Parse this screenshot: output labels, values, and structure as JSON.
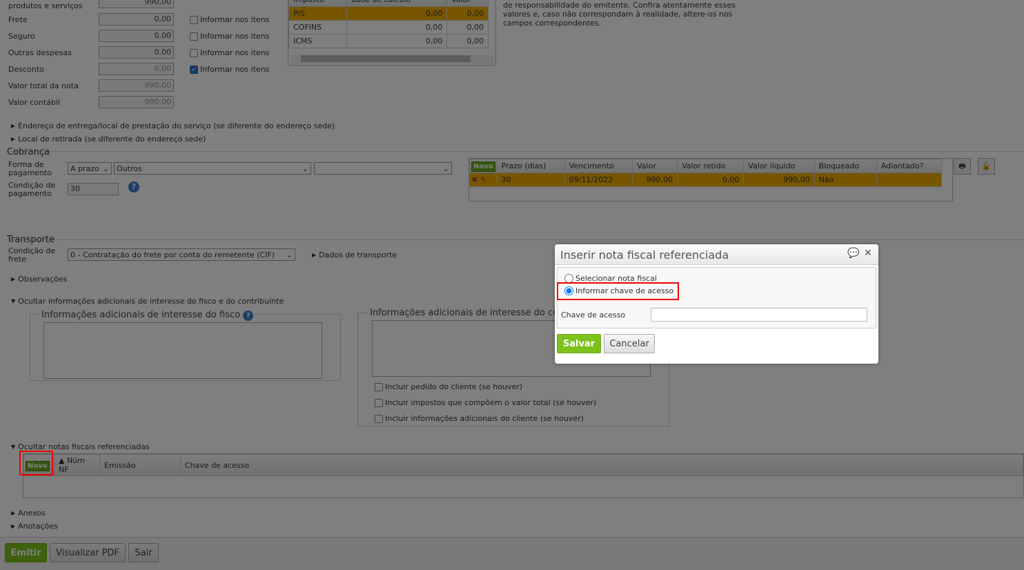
{
  "totals": {
    "rows": [
      {
        "label": "produtos e serviços",
        "value": "990,00"
      },
      {
        "label": "Frete",
        "value": "0,00",
        "check": "Informar nos itens",
        "checked": false
      },
      {
        "label": "Seguro",
        "value": "0,00",
        "check": "Informar nos itens",
        "checked": false
      },
      {
        "label": "Outras despesas",
        "value": "0,00",
        "check": "Informar nos itens",
        "checked": false
      },
      {
        "label": "Desconto",
        "value": "0,00",
        "check": "Informar nos itens",
        "checked": true
      },
      {
        "label": "Valor total da nota",
        "value": "990,00"
      },
      {
        "label": "Valor contábil",
        "value": "990,00"
      }
    ]
  },
  "tax_table": {
    "headers": [
      "Imposto",
      "Base de cálculo",
      "Valor"
    ],
    "rows": [
      [
        "PIS",
        "0,00",
        "0,00"
      ],
      [
        "COFINS",
        "0,00",
        "0,00"
      ],
      [
        "ICMS",
        "0,00",
        "0,00"
      ]
    ]
  },
  "notice": "de responsabilidade do emitente. Confira atentamente esses valores e, caso não correspondam à realidade, altere-os nos campos correspondentes.",
  "sections": {
    "entrega": "Endereço de entrega/local de prestação do serviço (se diferente do endereço sede)",
    "retirada": "Local de retirada (se diferente do endereço sede)",
    "observacoes": "Observações",
    "info_adic": "Ocultar informações adicionais de interesse do fisco e do contribuinte",
    "notas_ref": "Ocultar notas fiscais referenciadas",
    "anexos": "Anexos",
    "anotacoes": "Anotações"
  },
  "cobranca": {
    "title": "Cobrança",
    "forma_label": "Forma de pagamento",
    "forma_value": "A prazo",
    "tipo_value": "Outros",
    "extra_value": "",
    "condicao_label": "Condição de pagamento",
    "condicao_value": "30",
    "novo": "Novo",
    "headers": [
      "Prazo (dias)",
      "Vencimento",
      "Valor",
      "Valor retido",
      "Valor líquido",
      "Bloqueado",
      "Adiantado?"
    ],
    "rows": [
      [
        "30",
        "09/11/2022",
        "990,00",
        "0,00",
        "990,00",
        "Não",
        ""
      ]
    ]
  },
  "transporte": {
    "title": "Transporte",
    "condicao_label": "Condição de frete",
    "condicao_value": "0 - Contratação do frete por conta do remetente (CIF)",
    "dados": "Dados de transporte"
  },
  "info": {
    "fisco_legend": "Informações adicionais de interesse do fisco",
    "contrib_legend": "Informações adicionais de interesse do co",
    "checks": [
      "Incluir pedido do cliente (se houver)",
      "Incluir impostos que compõem o valor total (se houver)",
      "Incluir informações adicionais do cliente (se houver)"
    ]
  },
  "notas_ref": {
    "novo": "Novo",
    "headers": [
      "Núm NF",
      "Emissão",
      "Chave de acesso"
    ]
  },
  "footer": {
    "emitir": "Emitir",
    "pdf": "Visualizar PDF",
    "sair": "Sair"
  },
  "dialog": {
    "title": "Inserir nota fiscal referenciada",
    "opt1": "Selecionar nota fiscal",
    "opt2": "Informar chave de acesso",
    "selected": "opt2",
    "chave_label": "Chave de acesso",
    "chave_value": "",
    "salvar": "Salvar",
    "cancelar": "Cancelar"
  }
}
